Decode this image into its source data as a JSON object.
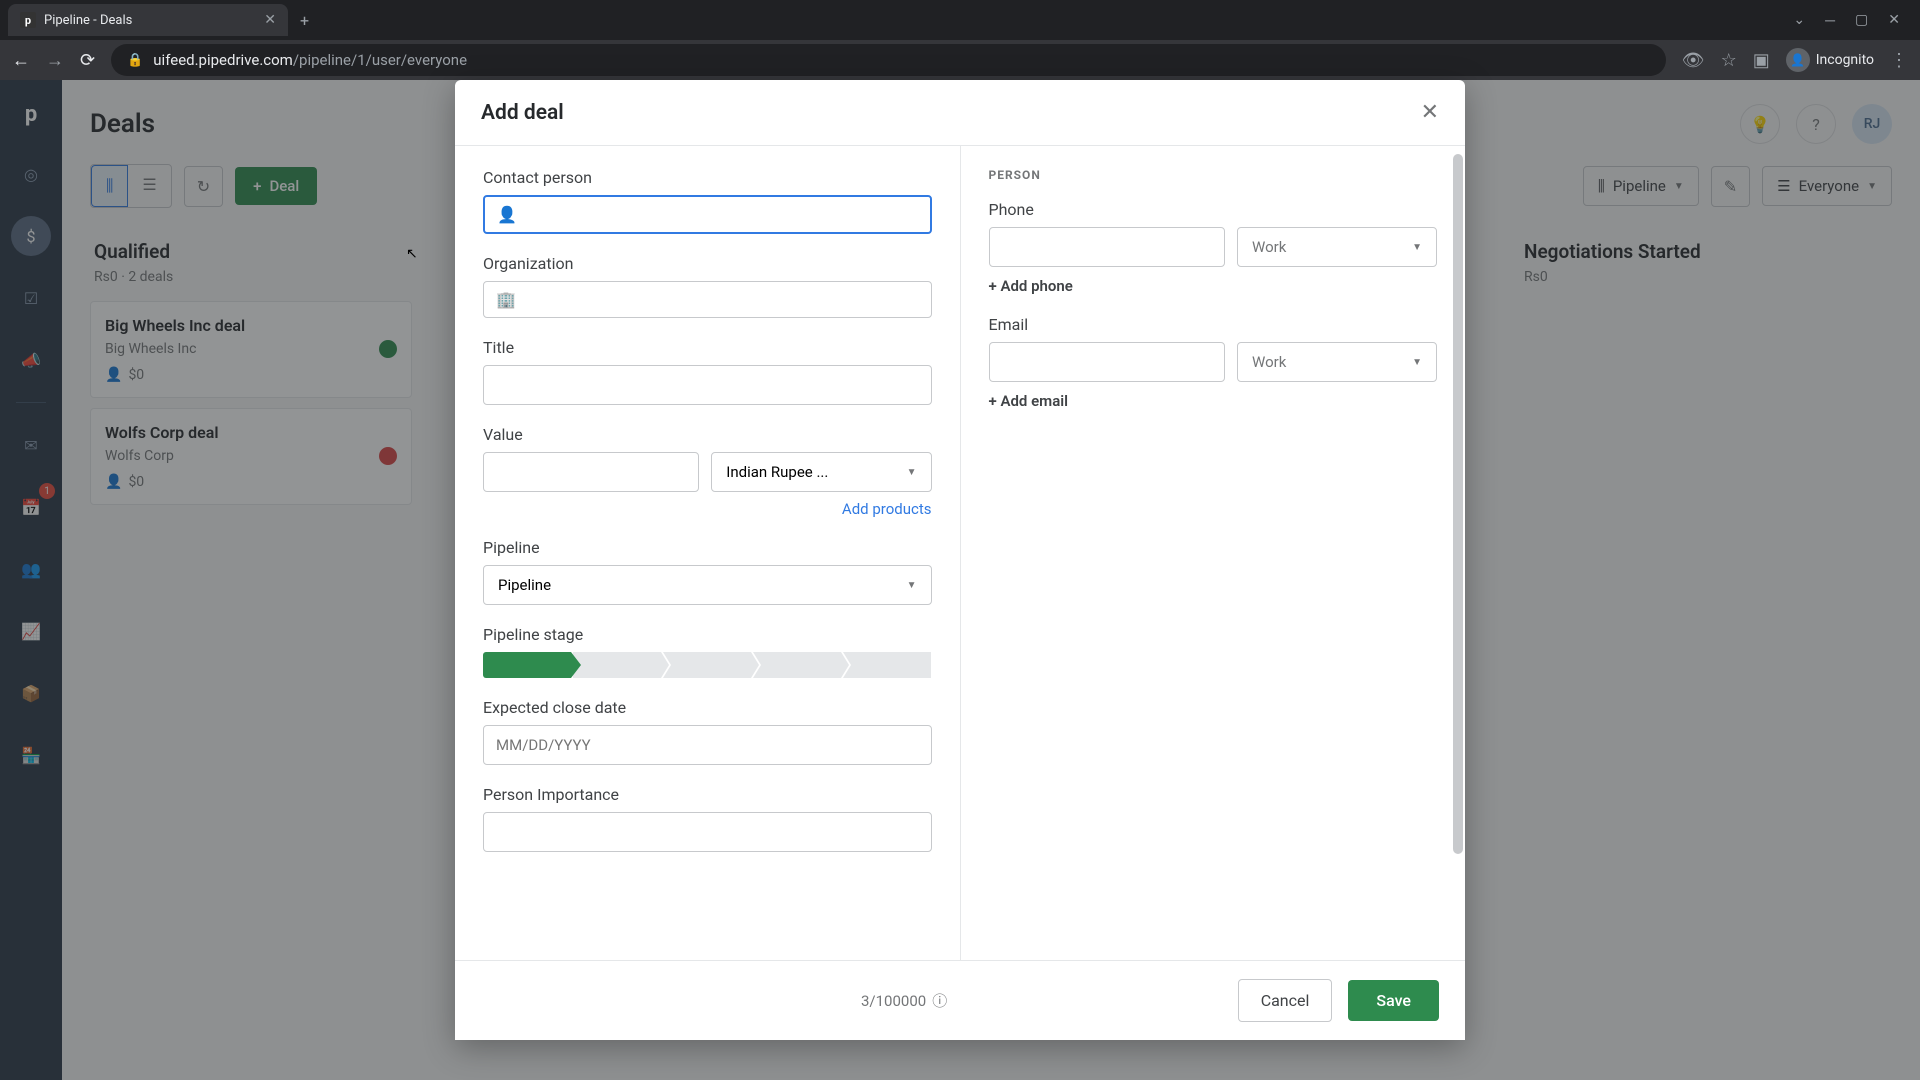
{
  "browser": {
    "tab_title": "Pipeline - Deals",
    "url_host": "uifeed.pipedrive.com",
    "url_path": "/pipeline/1/user/everyone",
    "incognito_label": "Incognito"
  },
  "page": {
    "title": "Deals",
    "user_initials": "RJ"
  },
  "toolbar": {
    "add_deal_label": "Deal",
    "pipeline_label": "Pipeline",
    "filter_label": "Everyone"
  },
  "sidebar": {
    "badge_count": "1"
  },
  "columns": [
    {
      "title": "Qualified",
      "meta": "Rs0 · 2 deals",
      "deals": [
        {
          "title": "Big Wheels Inc deal",
          "org": "Big Wheels Inc",
          "value": "$0",
          "status": "green"
        },
        {
          "title": "Wolfs Corp deal",
          "org": "Wolfs Corp",
          "value": "$0",
          "status": "red"
        }
      ]
    },
    {
      "title": "Negotiations Started",
      "meta": "Rs0",
      "deals": []
    }
  ],
  "modal": {
    "title": "Add deal",
    "labels": {
      "contact_person": "Contact person",
      "organization": "Organization",
      "title": "Title",
      "value": "Value",
      "currency": "Indian Rupee ...",
      "add_products": "Add products",
      "pipeline": "Pipeline",
      "pipeline_value": "Pipeline",
      "pipeline_stage": "Pipeline stage",
      "expected_close": "Expected close date",
      "close_placeholder": "MM/DD/YYYY",
      "person_importance": "Person Importance"
    },
    "right": {
      "section": "PERSON",
      "phone_label": "Phone",
      "phone_type": "Work",
      "add_phone": "+ Add phone",
      "email_label": "Email",
      "email_type": "Work",
      "add_email": "+ Add email"
    },
    "footer": {
      "counter": "3/100000",
      "cancel": "Cancel",
      "save": "Save"
    }
  }
}
